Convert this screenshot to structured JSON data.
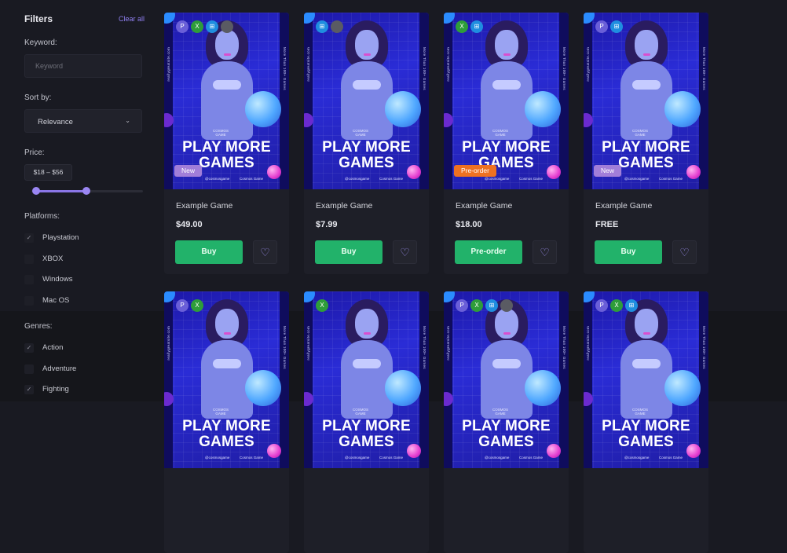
{
  "sidebar": {
    "title": "Filters",
    "clear_all": "Clear all",
    "keyword": {
      "label": "Keyword:",
      "placeholder": "Keyword",
      "value": ""
    },
    "sort": {
      "label": "Sort by:",
      "selected": "Relevance"
    },
    "price": {
      "label": "Price:",
      "range_text": "$18 – $56",
      "slider_low_fraction": 0.04,
      "slider_high_fraction": 0.49
    },
    "platforms": {
      "label": "Platforms:",
      "options": [
        {
          "label": "Playstation",
          "checked": true
        },
        {
          "label": "XBOX",
          "checked": false
        },
        {
          "label": "Windows",
          "checked": false
        },
        {
          "label": "Mac OS",
          "checked": false
        }
      ]
    },
    "genres": {
      "label": "Genres:",
      "options": [
        {
          "label": "Action",
          "checked": true
        },
        {
          "label": "Adventure",
          "checked": false
        },
        {
          "label": "Fighting",
          "checked": true
        }
      ]
    }
  },
  "cover_text": {
    "headline_1": "PLAY MORE",
    "headline_2": "GAMES",
    "logo_line1": "COSMOS",
    "logo_line2": "GAME",
    "side_left": "reallygreatsite.com",
    "side_right": "More Than 100+ Games",
    "social_1": "@cosmosgame",
    "social_2": "Cosmos Game"
  },
  "icons": {
    "check": "✓",
    "chevron": "⌄",
    "heart": "♡",
    "playstation": "P",
    "xbox": "X",
    "windows": "⊞",
    "mac": ""
  },
  "products": [
    {
      "name": "Example Game",
      "price": "$49.00",
      "button": "Buy",
      "badge": "New",
      "badge_type": "new",
      "platforms": [
        "ps",
        "xb",
        "win",
        "mac"
      ]
    },
    {
      "name": "Example Game",
      "price": "$7.99",
      "button": "Buy",
      "badge": "",
      "badge_type": "",
      "platforms": [
        "win",
        "mac"
      ]
    },
    {
      "name": "Example Game",
      "price": "$18.00",
      "button": "Pre-order",
      "badge": "Pre-order",
      "badge_type": "pre",
      "platforms": [
        "xb",
        "win"
      ]
    },
    {
      "name": "Example Game",
      "price": "FREE",
      "button": "Buy",
      "badge": "New",
      "badge_type": "new",
      "platforms": [
        "ps",
        "win"
      ]
    },
    {
      "name": "",
      "price": "",
      "button": "",
      "badge": "",
      "badge_type": "",
      "platforms": [
        "ps",
        "xb"
      ]
    },
    {
      "name": "",
      "price": "",
      "button": "",
      "badge": "",
      "badge_type": "",
      "platforms": [
        "xb"
      ]
    },
    {
      "name": "",
      "price": "",
      "button": "",
      "badge": "",
      "badge_type": "",
      "platforms": [
        "ps",
        "xb",
        "win",
        "mac"
      ]
    },
    {
      "name": "",
      "price": "",
      "button": "",
      "badge": "",
      "badge_type": "",
      "platforms": [
        "ps",
        "xb",
        "win"
      ]
    }
  ],
  "colors": {
    "accent": "#8a76e6",
    "buy_green": "#22b26a",
    "preorder_orange": "#ee7122",
    "new_purple": "#a17ed9"
  }
}
